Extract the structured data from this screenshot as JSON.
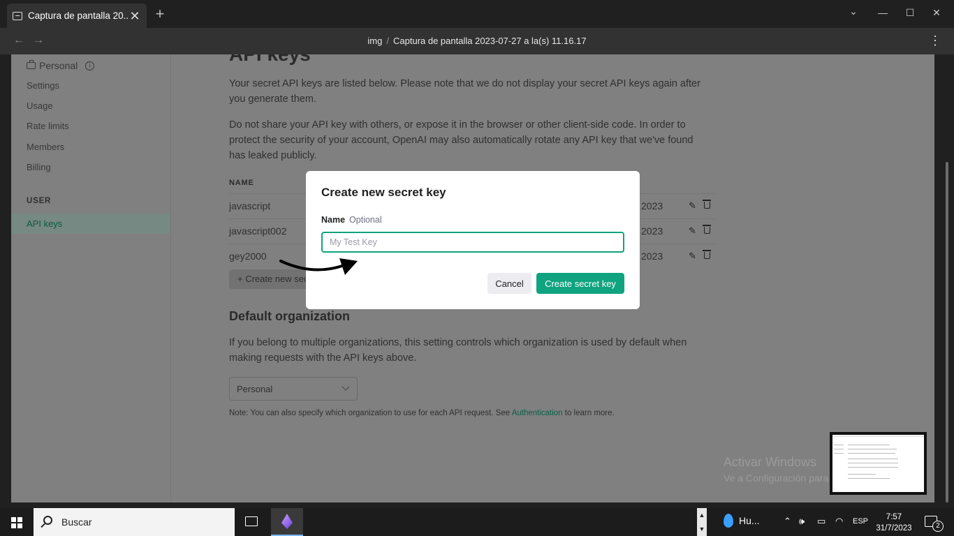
{
  "browser": {
    "tab_title": "Captura de pantalla 20...",
    "new_tab": "+",
    "close": "✕",
    "breadcrumb": {
      "folder": "img",
      "separator": "/",
      "file": "Captura de pantalla 2023-07-27 a la(s) 11.16.17"
    },
    "menu": "⋮",
    "back": "←",
    "forward": "→",
    "controls": {
      "dropdown": "⌄",
      "minimize": "—",
      "maximize": "☐",
      "close": "✕"
    }
  },
  "sidebar": {
    "org": "Personal",
    "items": [
      "Settings",
      "Usage",
      "Rate limits",
      "Members",
      "Billing"
    ],
    "section": "USER",
    "active": "API keys"
  },
  "main": {
    "title": "API keys",
    "intro": "Your secret API keys are listed below. Please note that we do not display your secret API keys again after you generate them.",
    "warning": "Do not share your API key with others, or expose it in the browser or other client-side code. In order to protect the security of your account, OpenAI may also automatically rotate any API key that we've found has leaked publicly.",
    "table_header_name": "NAME",
    "keys": [
      {
        "name": "javascript",
        "date": "2023"
      },
      {
        "name": "javascript002",
        "date": "2023"
      },
      {
        "name": "gey2000",
        "date": "2023"
      }
    ],
    "create_button": "+ Create new secret key",
    "default_org_title": "Default organization",
    "default_org_text": "If you belong to multiple organizations, this setting controls which organization is used by default when making requests with the API keys above.",
    "org_select": "Personal",
    "note_prefix": "Note: You can also specify which organization to use for each API request. See ",
    "note_link": "Authentication",
    "note_suffix": " to learn more."
  },
  "modal": {
    "title": "Create new secret key",
    "label": "Name",
    "label_hint": "Optional",
    "placeholder": "My Test Key",
    "value": "",
    "cancel": "Cancel",
    "submit": "Create secret key"
  },
  "watermark": {
    "line1": "Activar Windows",
    "line2": "Ve a Configuración para activar Windows."
  },
  "taskbar": {
    "search": "Buscar",
    "weather": "Hu...",
    "lang": "ESP",
    "time": "7:57",
    "date": "31/7/2023",
    "notifications": "2"
  },
  "colors": {
    "accent": "#10a37f",
    "overlay": "#808080",
    "taskbar": "#1c1c1c"
  }
}
